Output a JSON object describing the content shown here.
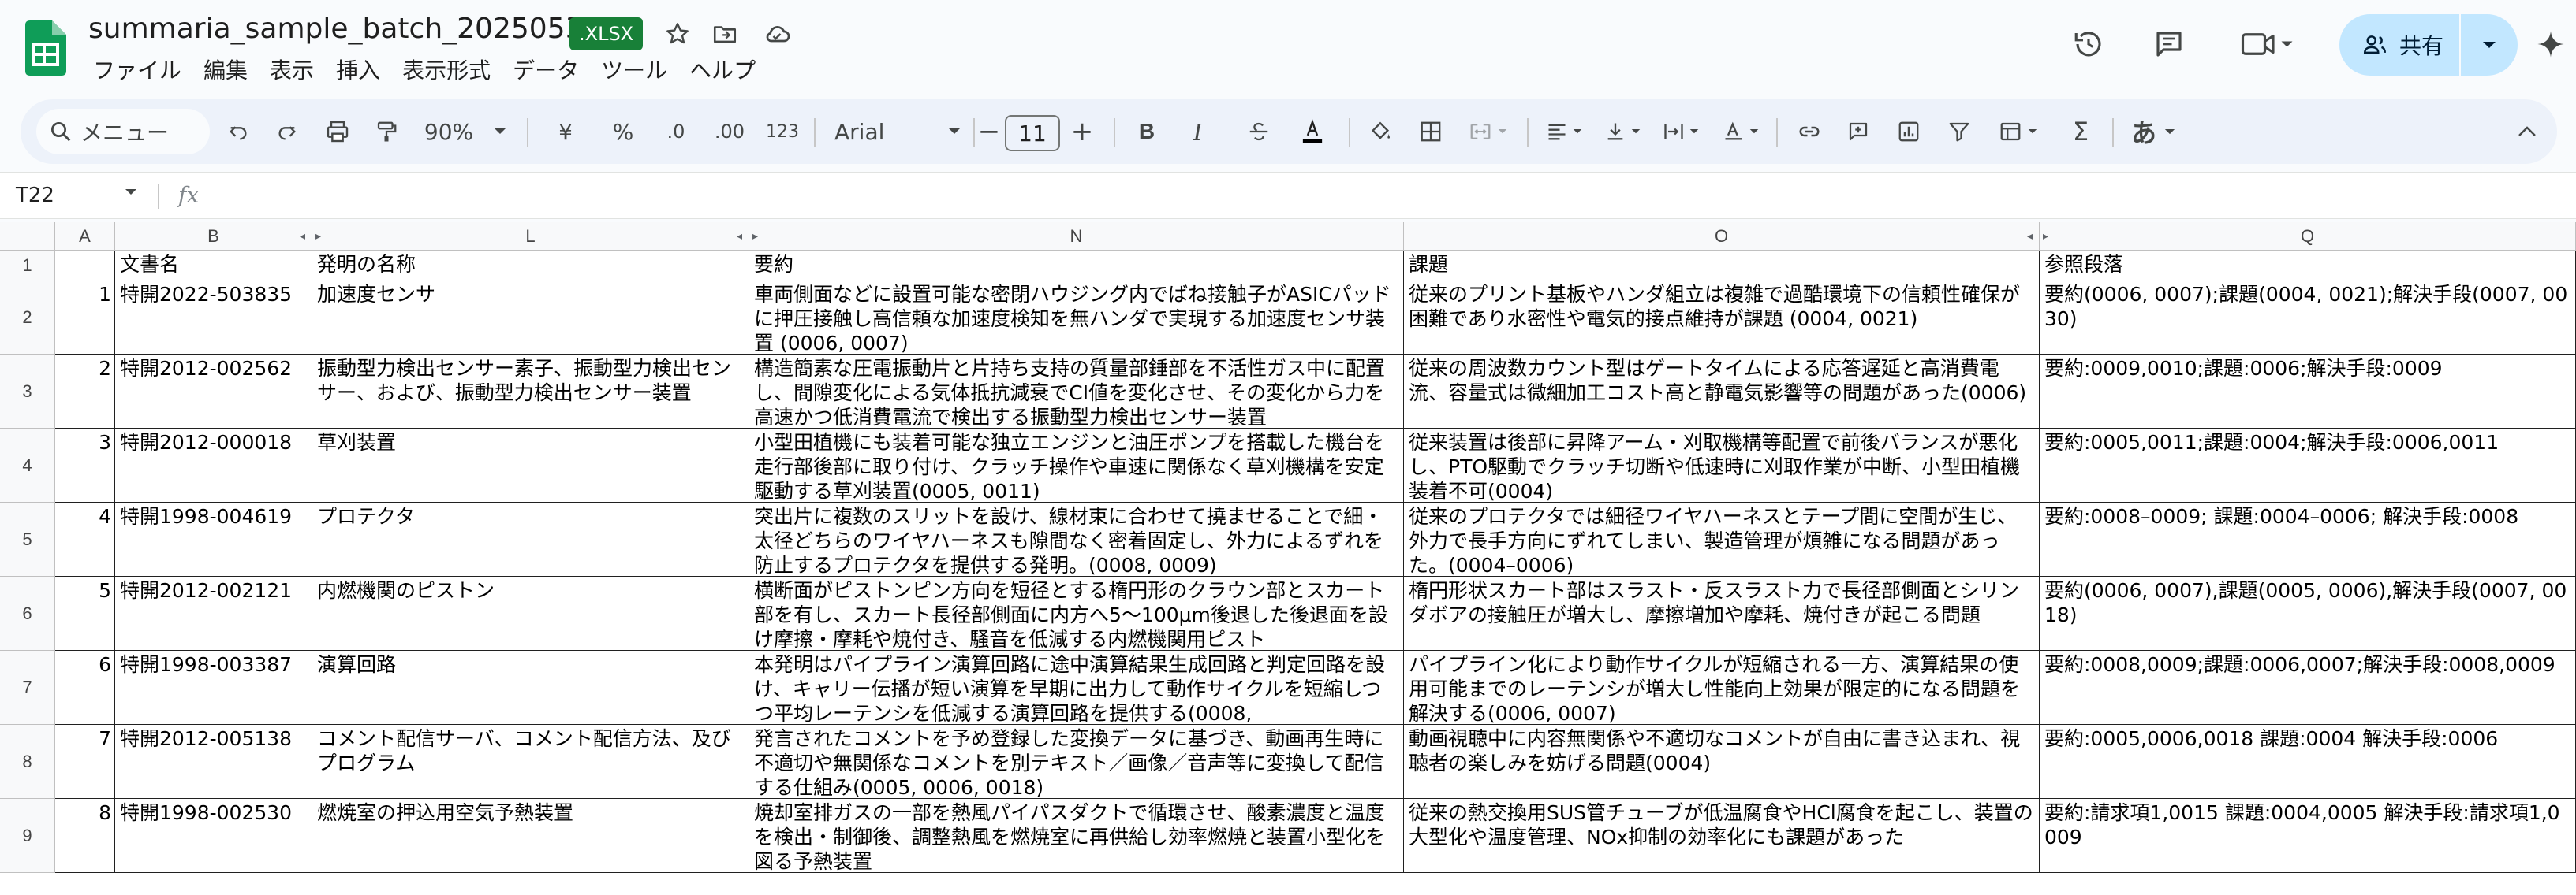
{
  "header": {
    "doc_title": "summaria_sample_batch_20250530",
    "badge": ".XLSX",
    "share_label": "共有",
    "menu": [
      "ファイル",
      "編集",
      "表示",
      "挿入",
      "表示形式",
      "データ",
      "ツール",
      "ヘルプ"
    ]
  },
  "toolbar": {
    "search_label": "メニュー",
    "zoom": "90%",
    "currency": "¥",
    "percent": "%",
    "dec_decrease": ".0",
    "dec_increase": ".00",
    "number_format": "123",
    "font": "Arial",
    "font_size": "11",
    "bold": "B",
    "italic": "I",
    "input_tools": "あ"
  },
  "formula_bar": {
    "cell_ref": "T22",
    "fx": "fx"
  },
  "columns": {
    "A": "A",
    "B": "B",
    "L": "L",
    "N": "N",
    "O": "O",
    "Q": "Q"
  },
  "row_numbers": [
    "1",
    "2",
    "3",
    "4",
    "5",
    "6",
    "7",
    "8",
    "9"
  ],
  "table": {
    "headers": {
      "name": "文書名",
      "title": "発明の名称",
      "summary": "要約",
      "issue": "課題",
      "ref": "参照段落"
    },
    "rows": [
      {
        "idx": "1",
        "name": "特開2022-503835",
        "title": "加速度センサ",
        "summary": "車両側面などに設置可能な密閉ハウジング内でばね接触子がASICパッドに押圧接触し高信頼な加速度検知を無ハンダで実現する加速度センサ装置 (0006, 0007)",
        "issue": "従来のプリント基板やハンダ組立は複雑で過酷環境下の信頼性確保が困難であり水密性や電気的接点維持が課題 (0004, 0021)",
        "ref": "要約(0006, 0007);課題(0004, 0021);解決手段(0007, 0030)"
      },
      {
        "idx": "2",
        "name": "特開2012-002562",
        "title": "振動型力検出センサー素子、振動型力検出センサー、および、振動型力検出センサー装置",
        "summary": "構造簡素な圧電振動片と片持ち支持の質量部錘部を不活性ガス中に配置し、間隙変化による気体抵抗減衰でCI値を変化させ、その変化から力を高速かつ低消費電流で検出する振動型力検出センサー装置",
        "issue": "従来の周波数カウント型はゲートタイムによる応答遅延と高消費電流、容量式は微細加工コスト高と静電気影響等の問題があった(0006)",
        "ref": "要約:0009,0010;課題:0006;解決手段:0009"
      },
      {
        "idx": "3",
        "name": "特開2012-000018",
        "title": "草刈装置",
        "summary": "小型田植機にも装着可能な独立エンジンと油圧ポンプを搭載した機台を走行部後部に取り付け、クラッチ操作や車速に関係なく草刈機構を安定駆動する草刈装置(0005, 0011)",
        "issue": "従来装置は後部に昇降アーム・刈取機構等配置で前後バランスが悪化し、PTO駆動でクラッチ切断や低速時に刈取作業が中断、小型田植機装着不可(0004)",
        "ref": "要約:0005,0011;課題:0004;解決手段:0006,0011"
      },
      {
        "idx": "4",
        "name": "特開1998-004619",
        "title": "プロテクタ",
        "summary": "突出片に複数のスリットを設け、線材束に合わせて撓ませることで細・太径どちらのワイヤハーネスも隙間なく密着固定し、外力によるずれを防止するプロテクタを提供する発明。(0008, 0009)",
        "issue": "従来のプロテクタでは細径ワイヤハーネスとテープ間に空間が生じ、外力で長手方向にずれてしまい、製造管理が煩雑になる問題があった。(0004–0006)",
        "ref": "要約:0008–0009; 課題:0004–0006; 解決手段:0008"
      },
      {
        "idx": "5",
        "name": "特開2012-002121",
        "title": "内燃機関のピストン",
        "summary": "横断面がピストンピン方向を短径とする楕円形のクラウン部とスカート部を有し、スカート長径部側面に内方へ5〜100μm後退した後退面を設け摩擦・摩耗や焼付き、騒音を低減する内燃機関用ピスト",
        "issue": "楕円形状スカート部はスラスト・反スラスト力で長径部側面とシリンダボアの接触圧が増大し、摩擦増加や摩耗、焼付きが起こる問題",
        "ref": "要約(0006, 0007),課題(0005, 0006),解決手段(0007, 0018)"
      },
      {
        "idx": "6",
        "name": "特開1998-003387",
        "title": "演算回路",
        "summary": "本発明はパイプライン演算回路に途中演算結果生成回路と判定回路を設け、キャリー伝播が短い演算を早期に出力して動作サイクルを短縮しつつ平均レーテンシを低減する演算回路を提供する(0008,",
        "issue": "パイプライン化により動作サイクルが短縮される一方、演算結果の使用可能までのレーテンシが増大し性能向上効果が限定的になる問題を解決する(0006, 0007)",
        "ref": "要約:0008,0009;課題:0006,0007;解決手段:0008,0009"
      },
      {
        "idx": "7",
        "name": "特開2012-005138",
        "title": "コメント配信サーバ、コメント配信方法、及びプログラム",
        "summary": "発言されたコメントを予め登録した変換データに基づき、動画再生時に不適切や無関係なコメントを別テキスト／画像／音声等に変換して配信する仕組み(0005, 0006, 0018)",
        "issue": "動画視聴中に内容無関係や不適切なコメントが自由に書き込まれ、視聴者の楽しみを妨げる問題(0004)",
        "ref": "要約:0005,0006,0018 課題:0004 解決手段:0006"
      },
      {
        "idx": "8",
        "name": "特開1998-002530",
        "title": "燃焼室の押込用空気予熱装置",
        "summary": "焼却室排ガスの一部を熱風パイパスダクトで循環させ、酸素濃度と温度を検出・制御後、調整熱風を燃焼室に再供給し効率燃焼と装置小型化を図る予熱装置",
        "issue": "従来の熱交換用SUS管チューブが低温腐食やHCl腐食を起こし、装置の大型化や温度管理、NOx抑制の効率化にも課題があった",
        "ref": "要約:請求項1,0015 課題:0004,0005 解決手段:請求項1,0009"
      }
    ]
  },
  "colors": {
    "sheets_green": "#0f9d58",
    "xlsx_badge": "#188038",
    "share_bg": "#c2e7ff",
    "toolbar_bg": "#edf2fa"
  },
  "icons": {
    "star": "star-icon",
    "move": "move-to-folder-icon",
    "cloud": "cloud-status-icon",
    "history": "history-icon",
    "comments": "comments-icon",
    "meet": "video-call-icon",
    "gemini": "gemini-sparkle-icon"
  }
}
